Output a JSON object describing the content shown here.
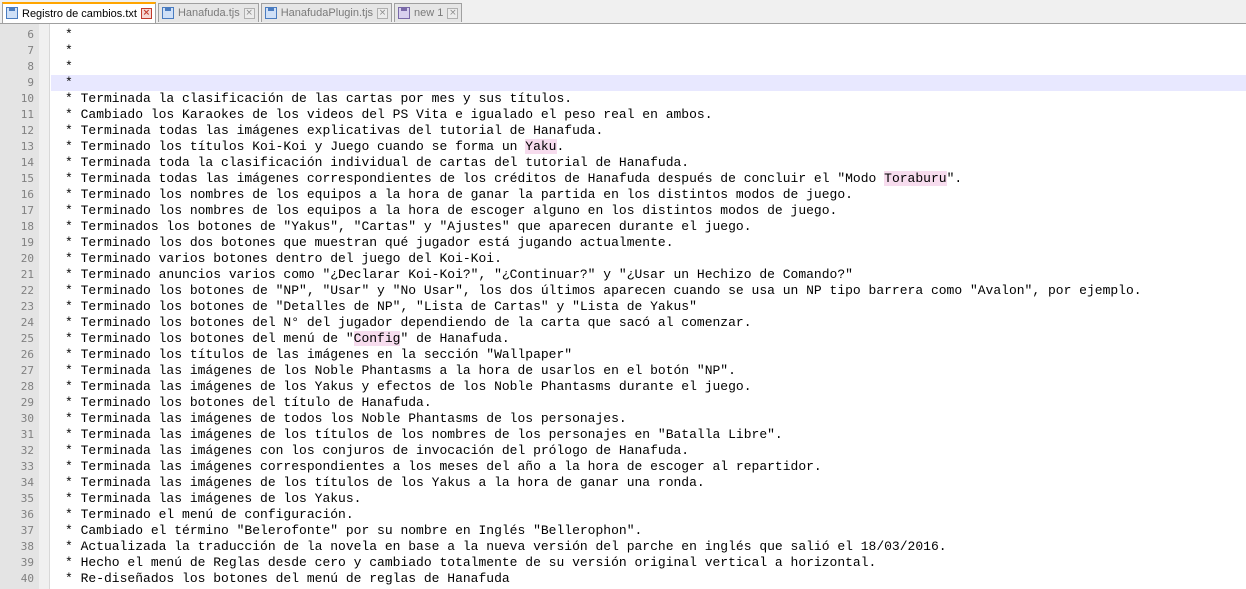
{
  "tabs": [
    {
      "label": "Registro de cambios.txt",
      "active": true,
      "icon": "file-saved-icon"
    },
    {
      "label": "Hanafuda.tjs",
      "active": false,
      "icon": "file-saved-icon"
    },
    {
      "label": "HanafudaPlugin.tjs",
      "active": false,
      "icon": "file-saved-icon"
    },
    {
      "label": "new 1",
      "active": false,
      "icon": "file-unsaved-icon"
    }
  ],
  "close_glyph": "×",
  "current_line": 9,
  "lines": [
    {
      "n": "6",
      "parts": [
        "*"
      ]
    },
    {
      "n": "7",
      "parts": [
        "*"
      ]
    },
    {
      "n": "8",
      "parts": [
        "*"
      ]
    },
    {
      "n": "9",
      "parts": [
        "*"
      ]
    },
    {
      "n": "10",
      "parts": [
        "* Terminada la clasificación de las cartas por mes y sus títulos."
      ]
    },
    {
      "n": "11",
      "parts": [
        "* Cambiado los Karaokes de los videos del PS Vita e igualado el peso real en ambos."
      ]
    },
    {
      "n": "12",
      "parts": [
        "* Terminada todas las imágenes explicativas del tutorial de Hanafuda."
      ]
    },
    {
      "n": "13",
      "parts": [
        "* Terminado los títulos Koi-Koi y Juego cuando se forma un ",
        {
          "hl": "Yaku"
        },
        "."
      ]
    },
    {
      "n": "14",
      "parts": [
        "* Terminada toda la clasificación individual de cartas del tutorial de Hanafuda."
      ]
    },
    {
      "n": "15",
      "parts": [
        "* Terminada todas las imágenes correspondientes de los créditos de Hanafuda después de concluir el \"Modo ",
        {
          "hl": "Toraburu"
        },
        "\"."
      ]
    },
    {
      "n": "16",
      "parts": [
        "* Terminado los nombres de los equipos a la hora de ganar la partida en los distintos modos de juego."
      ]
    },
    {
      "n": "17",
      "parts": [
        "* Terminado los nombres de los equipos a la hora de escoger alguno en los distintos modos de juego."
      ]
    },
    {
      "n": "18",
      "parts": [
        "* Terminados los botones de \"Yakus\", \"Cartas\" y \"Ajustes\" que aparecen durante el juego."
      ]
    },
    {
      "n": "19",
      "parts": [
        "* Terminado los dos botones que muestran qué jugador está jugando actualmente."
      ]
    },
    {
      "n": "20",
      "parts": [
        "* Terminado varios botones dentro del juego del Koi-Koi."
      ]
    },
    {
      "n": "21",
      "parts": [
        "* Terminado anuncios varios como \"¿Declarar Koi-Koi?\", \"¿Continuar?\" y \"¿Usar un Hechizo de Comando?\""
      ]
    },
    {
      "n": "22",
      "parts": [
        "* Terminado los botones de \"NP\", \"Usar\" y \"No Usar\", los dos últimos aparecen cuando se usa un NP tipo barrera como \"Avalon\", por ejemplo."
      ]
    },
    {
      "n": "23",
      "parts": [
        "* Terminado los botones de \"Detalles de NP\", \"Lista de Cartas\" y \"Lista de Yakus\""
      ]
    },
    {
      "n": "24",
      "parts": [
        "* Terminado los botones del N° del jugador dependiendo de la carta que sacó al comenzar."
      ]
    },
    {
      "n": "25",
      "parts": [
        "* Terminado los botones del menú de \"",
        {
          "hl": "Config"
        },
        "\" de Hanafuda."
      ]
    },
    {
      "n": "26",
      "parts": [
        "* Terminado los títulos de las imágenes en la sección \"Wallpaper\""
      ]
    },
    {
      "n": "27",
      "parts": [
        "* Terminada las imágenes de los Noble Phantasms a la hora de usarlos en el botón \"NP\"."
      ]
    },
    {
      "n": "28",
      "parts": [
        "* Terminada las imágenes de los Yakus y efectos de los Noble Phantasms durante el juego."
      ]
    },
    {
      "n": "29",
      "parts": [
        "* Terminado los botones del título de Hanafuda."
      ]
    },
    {
      "n": "30",
      "parts": [
        "* Terminada las imágenes de todos los Noble Phantasms de los personajes."
      ]
    },
    {
      "n": "31",
      "parts": [
        "* Terminada las imágenes de los títulos de los nombres de los personajes en \"Batalla Libre\"."
      ]
    },
    {
      "n": "32",
      "parts": [
        "* Terminada las imágenes con los conjuros de invocación del prólogo de Hanafuda."
      ]
    },
    {
      "n": "33",
      "parts": [
        "* Terminada las imágenes correspondientes a los meses del año a la hora de escoger al repartidor."
      ]
    },
    {
      "n": "34",
      "parts": [
        "* Terminada las imágenes de los títulos de los Yakus a la hora de ganar una ronda."
      ]
    },
    {
      "n": "35",
      "parts": [
        "* Terminada las imágenes de los Yakus."
      ]
    },
    {
      "n": "36",
      "parts": [
        "* Terminado el menú de configuración."
      ]
    },
    {
      "n": "37",
      "parts": [
        "* Cambiado el término \"Belerofonte\" por su nombre en Inglés \"Bellerophon\"."
      ]
    },
    {
      "n": "38",
      "parts": [
        "* Actualizada la traducción de la novela en base a la nueva versión del parche en inglés que salió el 18/03/2016."
      ]
    },
    {
      "n": "39",
      "parts": [
        "* Hecho el menú de Reglas desde cero y cambiado totalmente de su versión original vertical a horizontal."
      ]
    },
    {
      "n": "40",
      "parts": [
        "* Re-diseñados los botones del menú de reglas de Hanafuda"
      ]
    }
  ]
}
